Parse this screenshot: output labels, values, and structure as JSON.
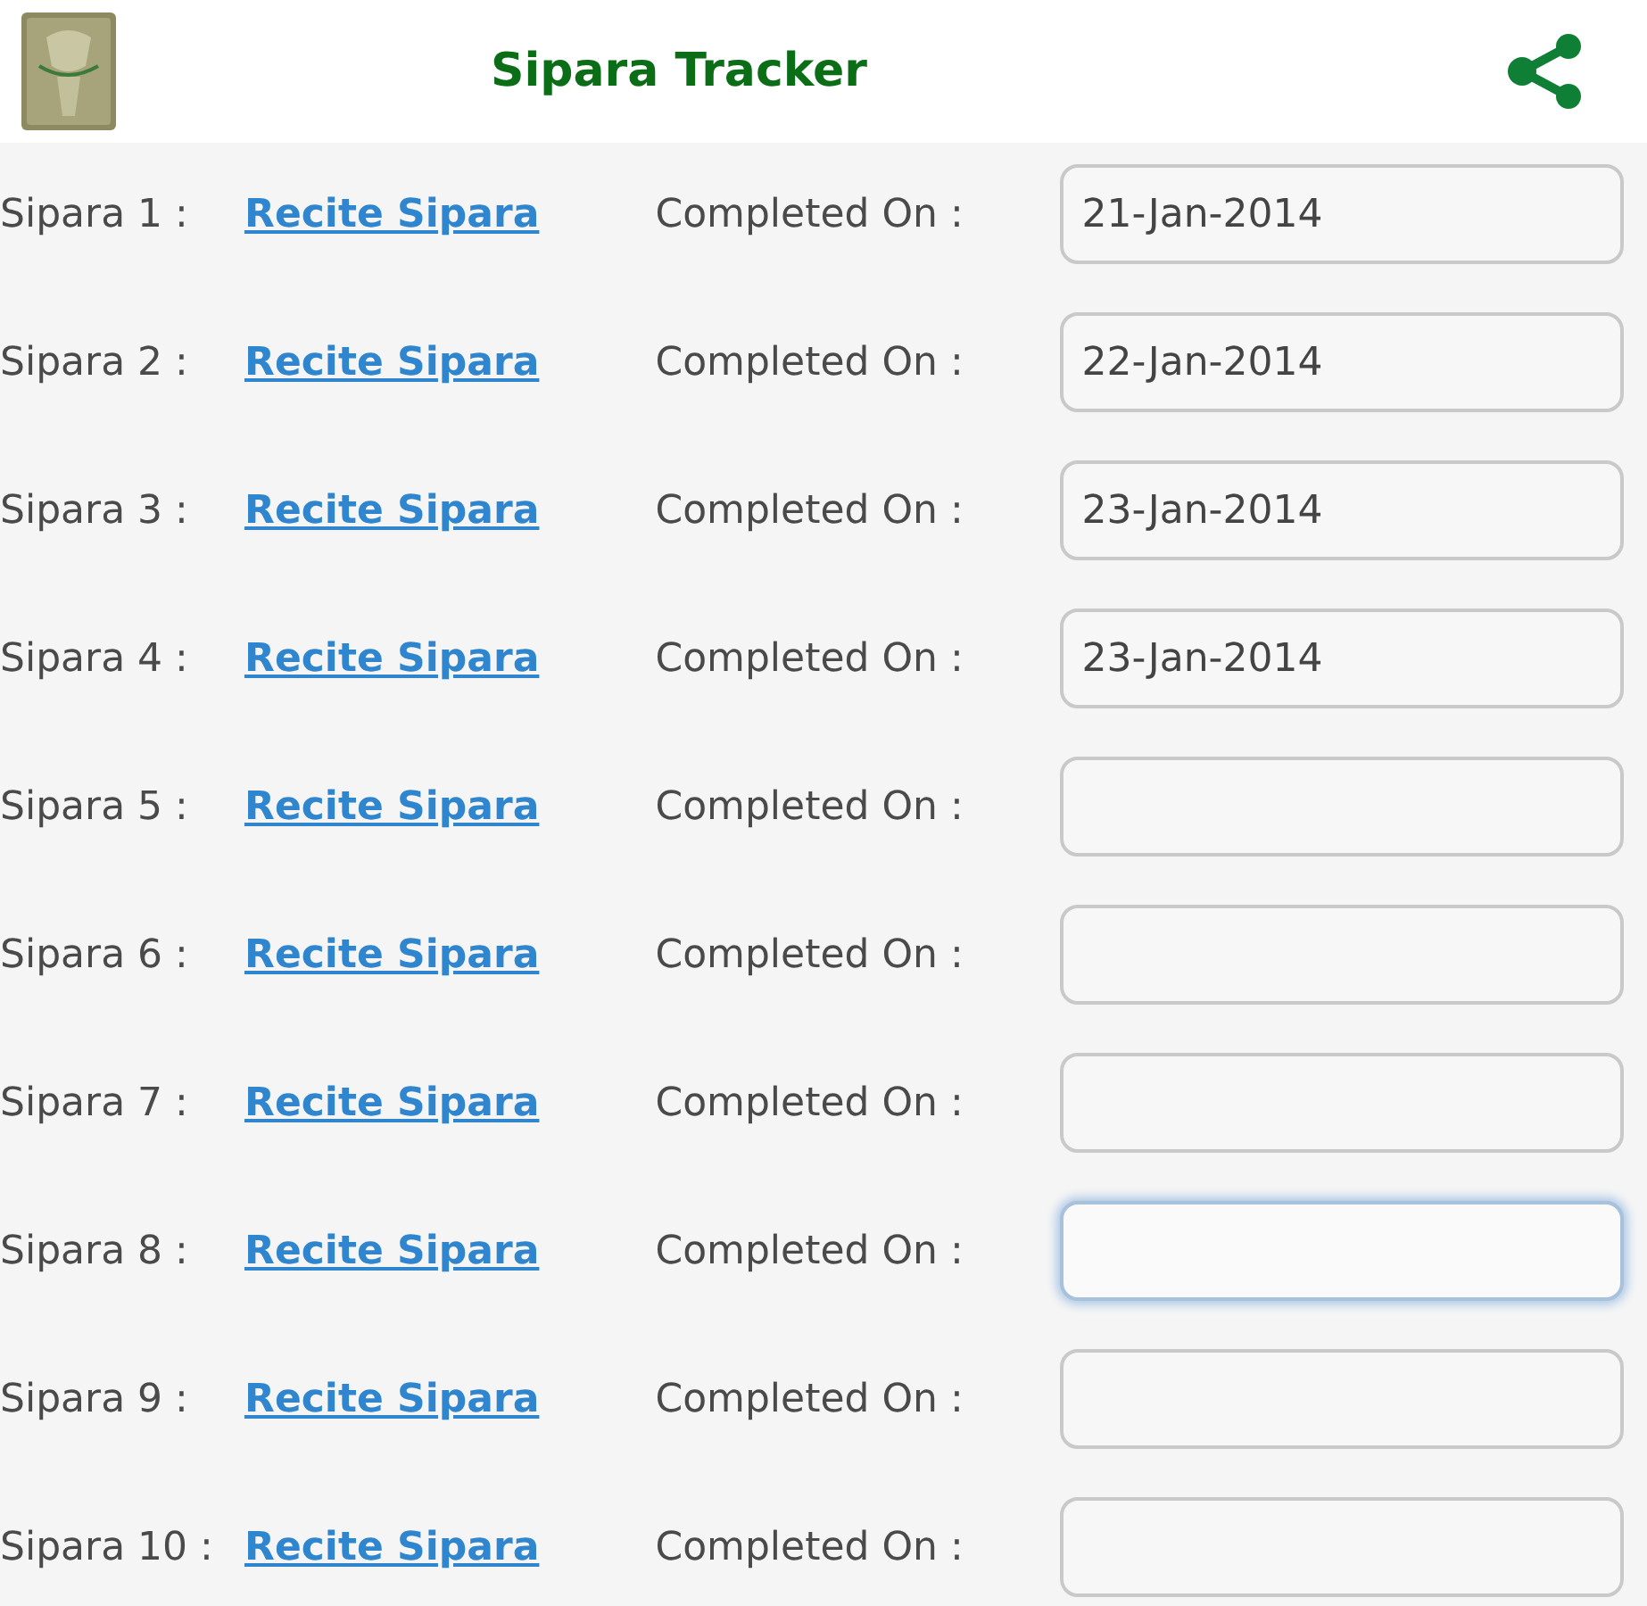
{
  "header": {
    "title": "Sipara Tracker"
  },
  "rows": [
    {
      "label": "Sipara 1 :",
      "link": "Recite Sipara",
      "completed_label": "Completed On :",
      "date": "21-Jan-2014",
      "focused": false
    },
    {
      "label": "Sipara 2 :",
      "link": "Recite Sipara",
      "completed_label": "Completed On :",
      "date": "22-Jan-2014",
      "focused": false
    },
    {
      "label": "Sipara 3 :",
      "link": "Recite Sipara",
      "completed_label": "Completed On :",
      "date": "23-Jan-2014",
      "focused": false
    },
    {
      "label": "Sipara 4 :",
      "link": "Recite Sipara",
      "completed_label": "Completed On :",
      "date": "23-Jan-2014",
      "focused": false
    },
    {
      "label": "Sipara 5 :",
      "link": "Recite Sipara",
      "completed_label": "Completed On :",
      "focused": false
    },
    {
      "label": "Sipara 6 :",
      "link": "Recite Sipara",
      "completed_label": "Completed On :",
      "focused": false
    },
    {
      "label": "Sipara 7 :",
      "link": "Recite Sipara",
      "completed_label": "Completed On :",
      "focused": false
    },
    {
      "label": "Sipara 8 :",
      "link": "Recite Sipara",
      "completed_label": "Completed On :",
      "focused": true
    },
    {
      "label": "Sipara 9 :",
      "link": "Recite Sipara",
      "completed_label": "Completed On :",
      "focused": false
    },
    {
      "label": "Sipara 10 :",
      "link": "Recite Sipara",
      "completed_label": "Completed On :",
      "focused": false
    }
  ]
}
